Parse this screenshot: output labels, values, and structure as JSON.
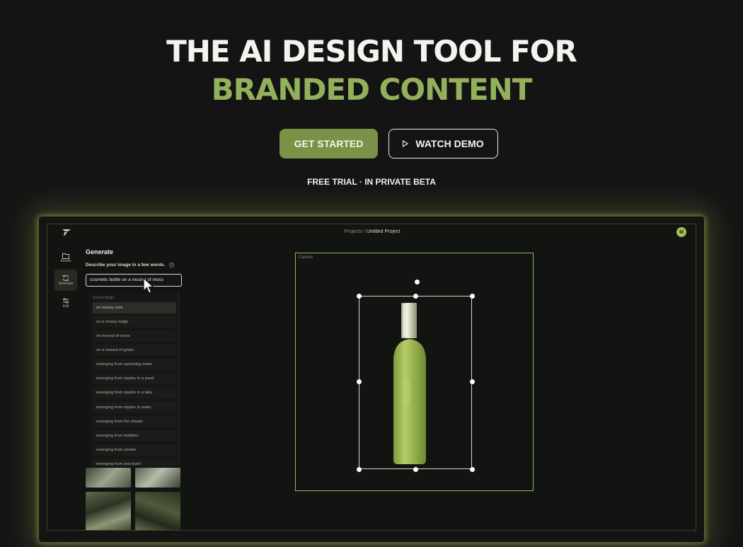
{
  "hero": {
    "title_line1": "THE AI DESIGN TOOL FOR",
    "title_line2": "BRANDED CONTENT",
    "primary_button": "GET STARTED",
    "secondary_button": "WATCH DEMO",
    "subtitle": "FREE TRIAL · IN PRIVATE BETA"
  },
  "app": {
    "breadcrumb_root": "Projects /",
    "breadcrumb_current": "Untitled Project",
    "avatar_initial": "M",
    "rail": [
      {
        "label": "Assets",
        "icon": "folder-icon"
      },
      {
        "label": "Generate",
        "icon": "refresh-icon"
      },
      {
        "label": "Edit",
        "icon": "sliders-icon"
      }
    ],
    "panel": {
      "title": "Generate",
      "description": "Describe your image in a few words.",
      "help": "?",
      "input_value": "cosmetic bottle on a mound of moss",
      "dropdown_header": "Surroundings",
      "suggestions": [
        "on mossy rock",
        "on a mossy ledge",
        "on mound of moss",
        "on a mound of grass",
        "emerging from splashing water",
        "emerging from ripples in a pond",
        "emerging from ripples in a lake",
        "emerging from ripples in water",
        "emerging from the clouds",
        "emerging from bubbles",
        "emerging from smoke",
        "emerging from sea foam"
      ]
    },
    "canvas_label": "Canvas"
  },
  "colors": {
    "background": "#141414",
    "accent": "#93b05a",
    "primary_button": "#7b9147",
    "canvas_border": "#9db45a"
  }
}
